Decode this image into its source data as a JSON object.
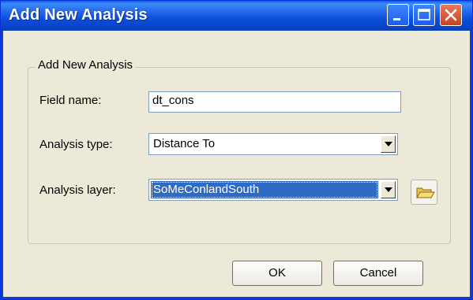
{
  "window": {
    "title": "Add New Analysis"
  },
  "group": {
    "label": "Add New Analysis"
  },
  "fields": {
    "field_name": {
      "label": "Field name:",
      "value": "dt_cons"
    },
    "analysis_type": {
      "label": "Analysis type:",
      "value": "Distance To"
    },
    "analysis_layer": {
      "label": "Analysis layer:",
      "value": "SoMeConlandSouth"
    }
  },
  "buttons": {
    "ok": "OK",
    "cancel": "Cancel"
  },
  "icons": {
    "minimize": "minimize-icon",
    "maximize": "maximize-icon",
    "close": "close-icon",
    "browse": "folder-open-icon",
    "dropdown": "chevron-down-icon"
  },
  "colors": {
    "titlebar": "#0a5fe3",
    "selection": "#316ac5",
    "face": "#ece9d8"
  }
}
